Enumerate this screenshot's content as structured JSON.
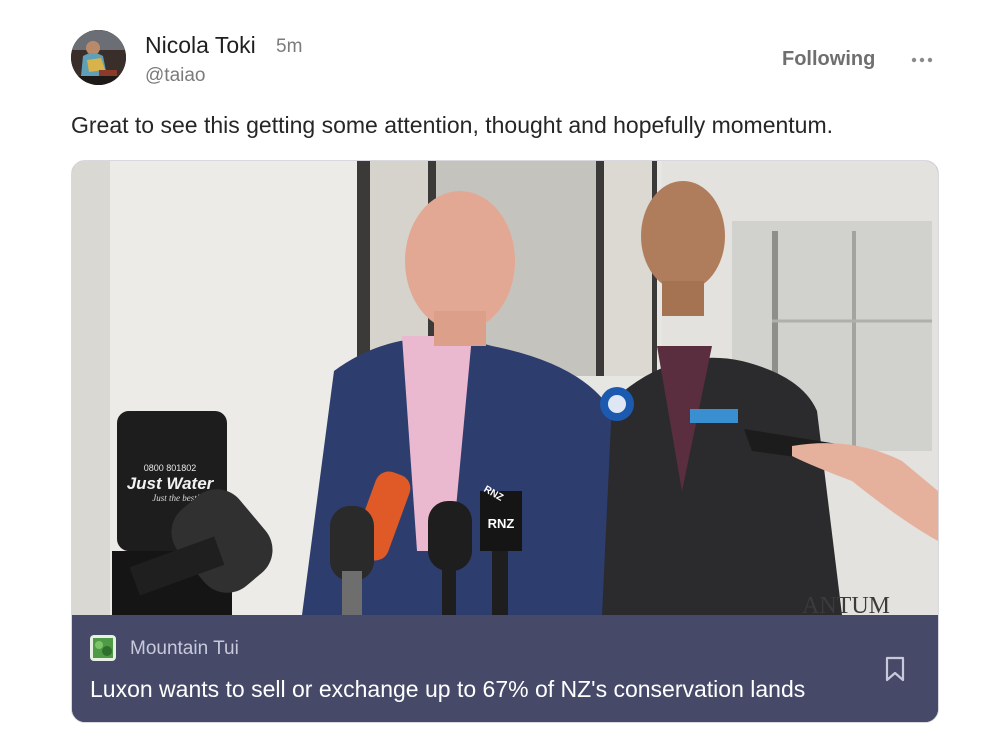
{
  "post": {
    "author_name": "Nicola Toki",
    "timestamp": "5m",
    "handle": "@taiao",
    "follow_label": "Following",
    "text": "Great to see this getting some attention, thought and hopefully momentum."
  },
  "link_card": {
    "source_name": "Mountain Tui",
    "title": "Luxon wants to sell or exchange up to 67% of NZ's conservation lands",
    "image_text": {
      "water_phone": "0800 801802",
      "water_brand": "Just Water",
      "water_tagline": "Just the best!",
      "mic_label_1": "RNZ",
      "mic_label_2": "RNZ",
      "wall_sign": "ANTUM"
    }
  },
  "icons": {
    "more": "more-horizontal-icon",
    "bookmark": "bookmark-icon"
  }
}
